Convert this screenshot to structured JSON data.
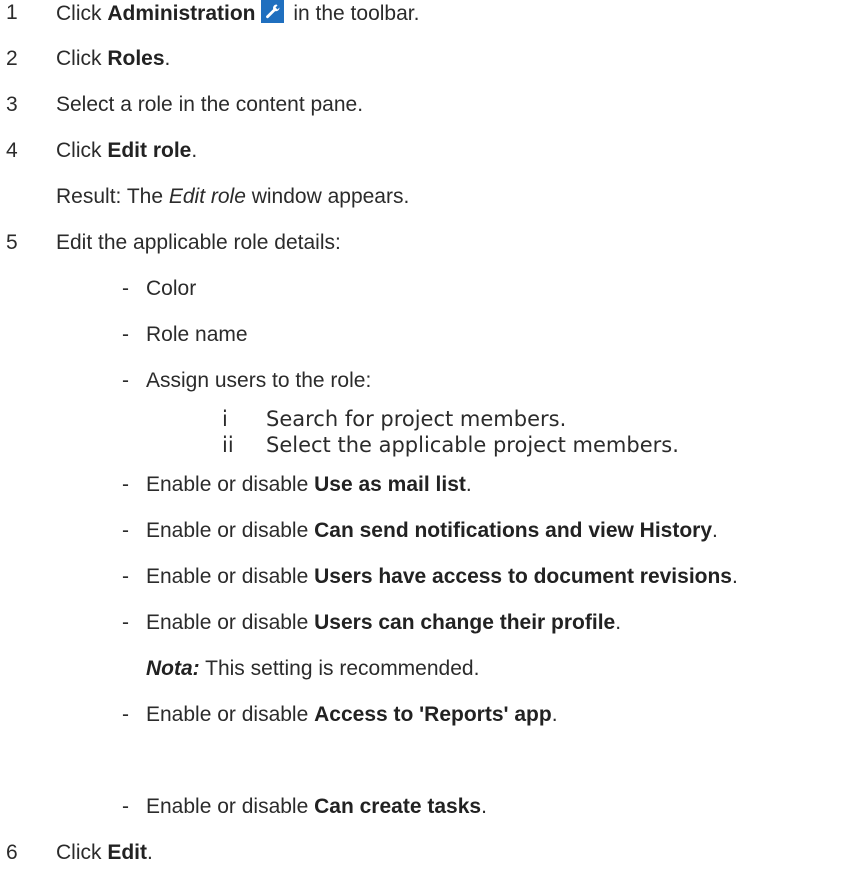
{
  "steps": [
    {
      "num": "1",
      "pre": "Click ",
      "bold": "Administration",
      "post": " in the toolbar.",
      "icon": "wrench-icon"
    },
    {
      "num": "2",
      "pre": "Click ",
      "bold": "Roles",
      "post": "."
    },
    {
      "num": "3",
      "text": "Select a role in the content pane."
    },
    {
      "num": "4",
      "pre": "Click ",
      "bold": "Edit role",
      "post": "."
    },
    {
      "result_pre": "Result: The ",
      "result_italic": "Edit role",
      "result_post": " window appears."
    },
    {
      "num": "5",
      "text": "Edit the applicable role details:"
    },
    {
      "num": "6",
      "pre": "Click ",
      "bold": "Edit",
      "post": "."
    }
  ],
  "bullets": [
    {
      "dash": "-",
      "text": "Color"
    },
    {
      "dash": "-",
      "text": "Role name"
    },
    {
      "dash": "-",
      "text": "Assign users to the role:"
    },
    {
      "dash": "-",
      "pre": "Enable or disable ",
      "bold": "Use as mail list",
      "post": "."
    },
    {
      "dash": "-",
      "pre": "Enable or disable ",
      "bold": "Can send notifications and view History",
      "post": "."
    },
    {
      "dash": "-",
      "pre": "Enable or disable ",
      "bold": "Users have access to document revisions",
      "post": "."
    },
    {
      "dash": "-",
      "pre": "Enable or disable ",
      "bold": "Users can change their profile",
      "post": "."
    },
    {
      "dash": "-",
      "pre": "Enable or disable ",
      "bold": "Access to 'Reports' app",
      "post": "."
    },
    {
      "dash": "-",
      "pre": "Enable or disable ",
      "bold": "Can create tasks",
      "post": "."
    }
  ],
  "substeps": [
    {
      "num": "i",
      "text": "Search for project members."
    },
    {
      "num": "ii",
      "text": "Select the applicable project members."
    }
  ],
  "note": {
    "label": "Nota:",
    "text": " This setting is recommended."
  }
}
